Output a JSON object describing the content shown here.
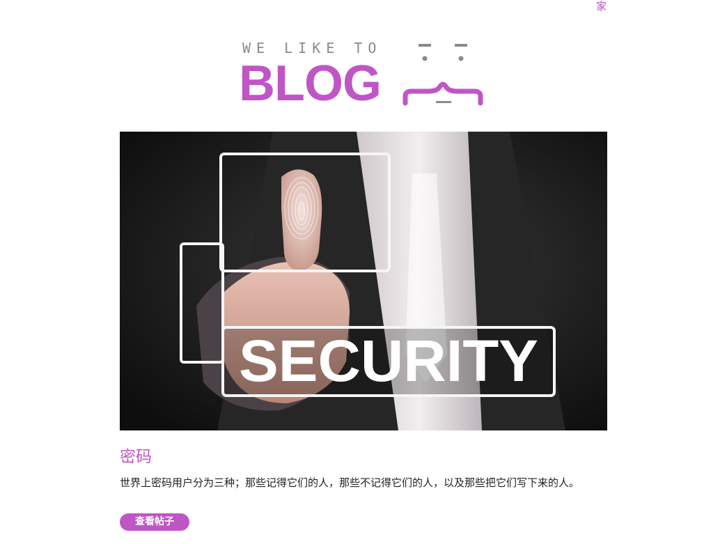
{
  "nav": {
    "home_label": "家"
  },
  "logo": {
    "tagline": "WE LIKE TO",
    "wordmark": "BLOG",
    "accent_color": "#c055c6",
    "tagline_color": "#8a8a8a"
  },
  "hero": {
    "image_text": "SECURITY",
    "icon": "fingerprint-security-image"
  },
  "post": {
    "title": "密码",
    "excerpt": "世界上密码用户分为三种；那些记得它们的人，那些不记得它们的人，以及那些把它们写下来的人。",
    "button_label": "查看帖子"
  }
}
